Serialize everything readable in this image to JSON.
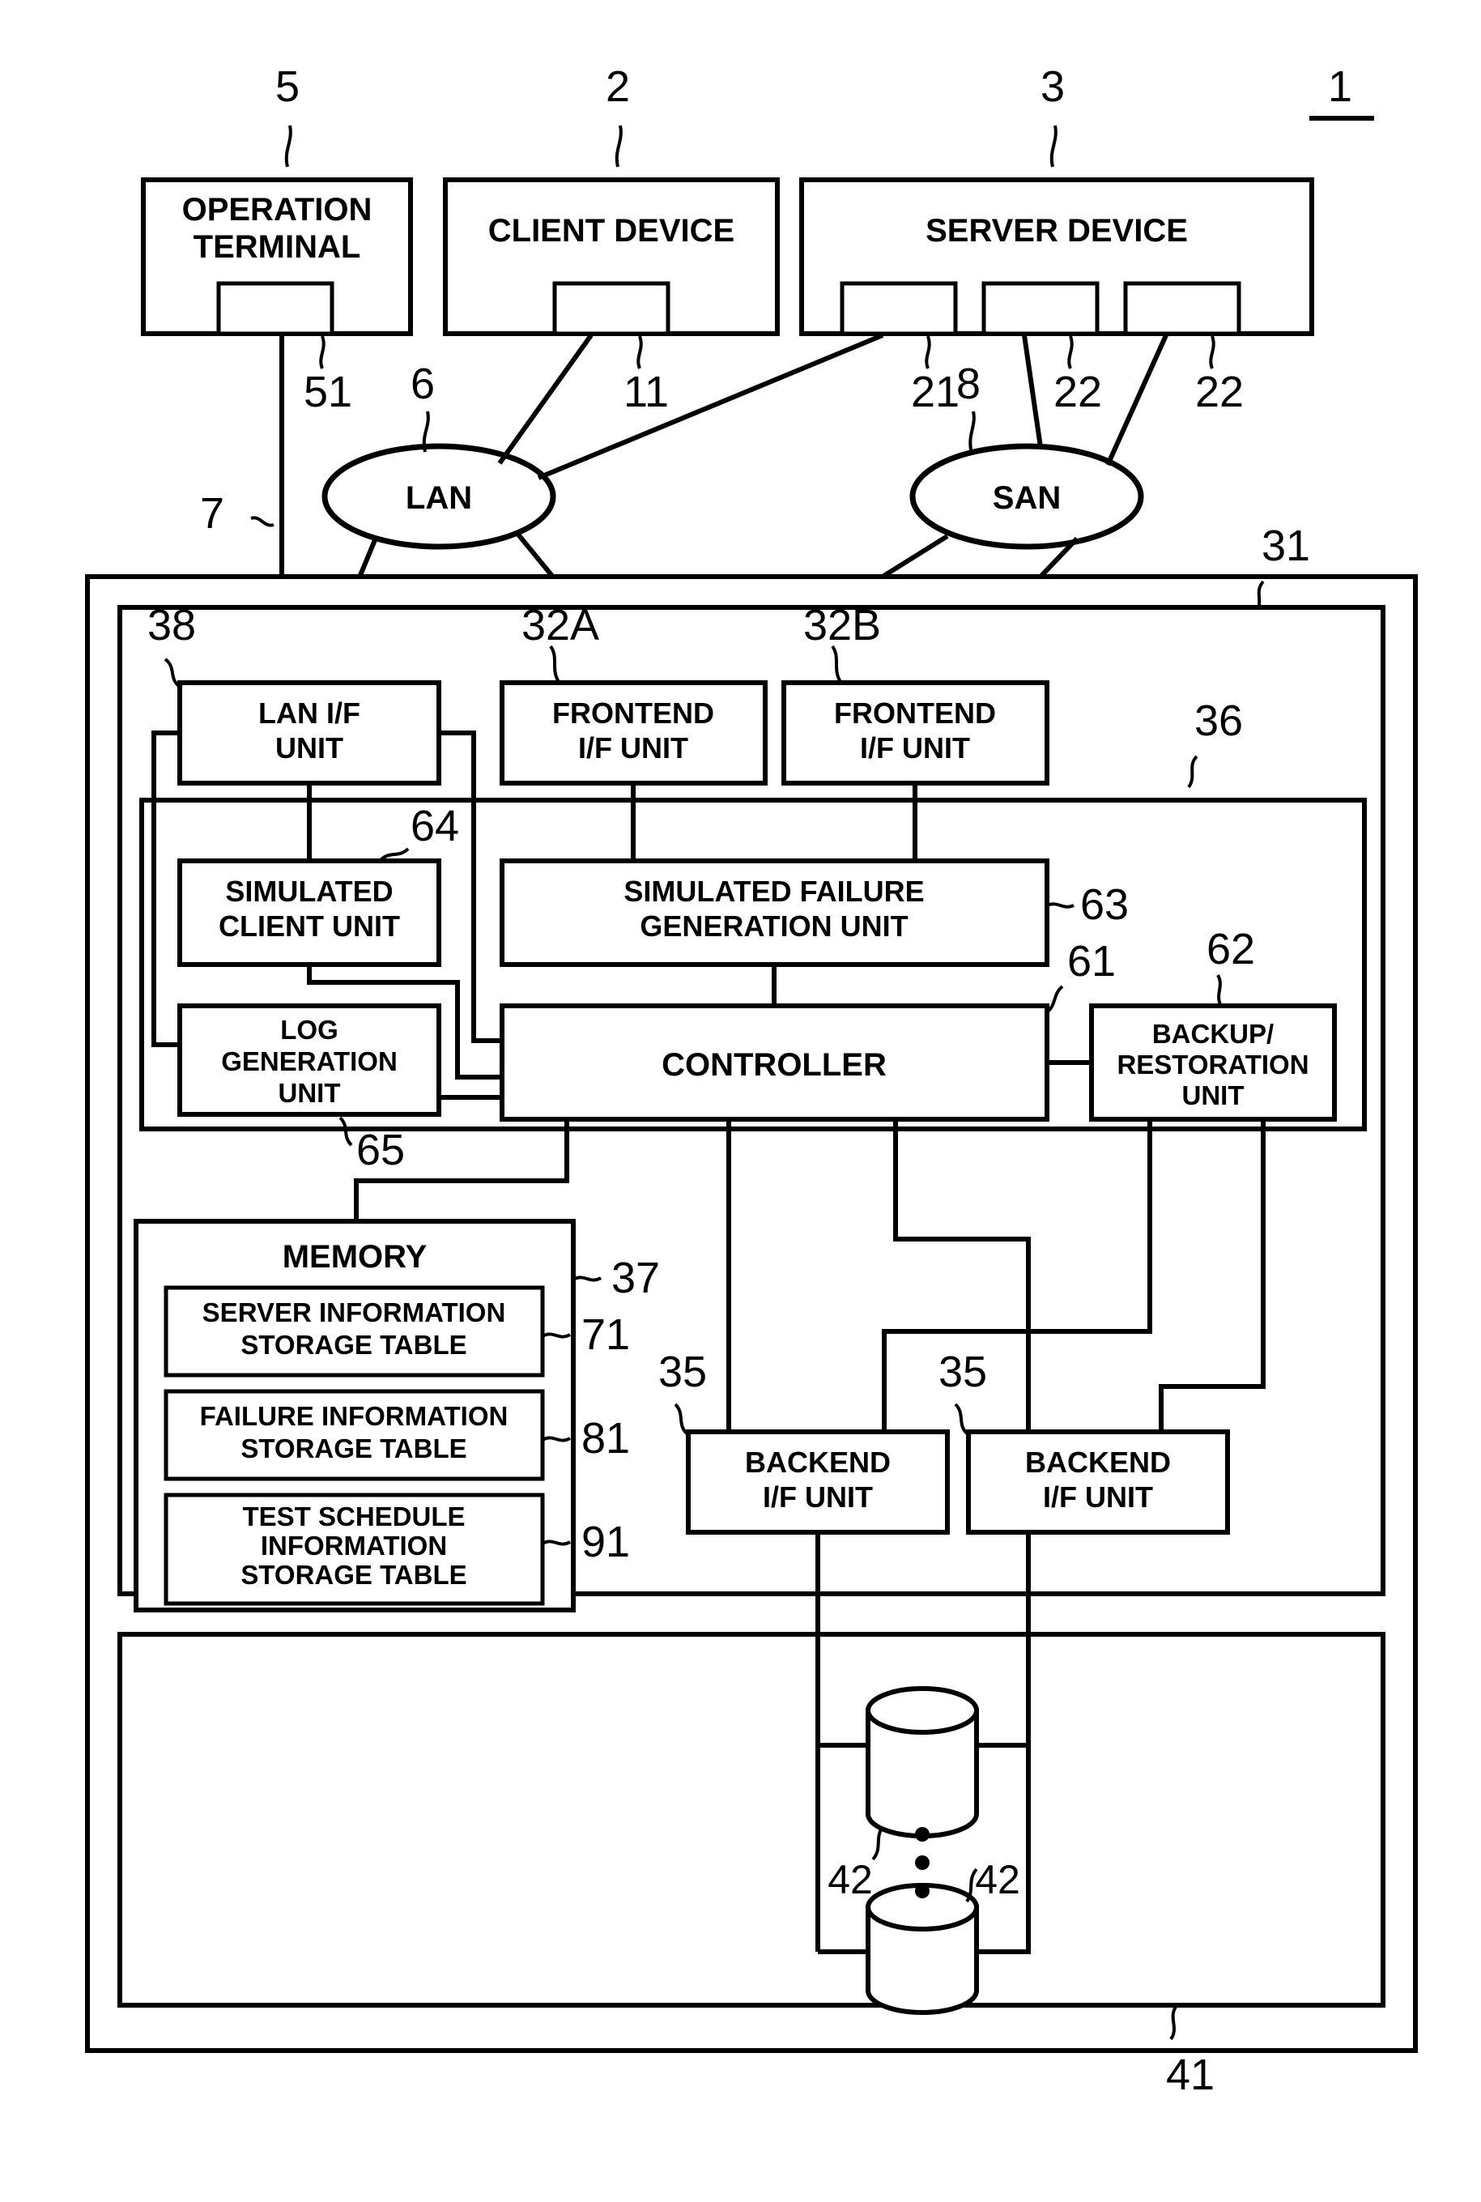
{
  "figure": {
    "figure_number": "1",
    "title_blocks": {
      "operation_terminal": "OPERATION\nTERMINAL",
      "operation_terminal_l1": "OPERATION",
      "operation_terminal_l2": "TERMINAL",
      "client_device": "CLIENT DEVICE",
      "server_device": "SERVER DEVICE"
    },
    "networks": {
      "lan": "LAN",
      "san": "SAN"
    },
    "interface_units": {
      "lan_if_l1": "LAN I/F",
      "lan_if_l2": "UNIT",
      "frontend_a_l1": "FRONTEND",
      "frontend_a_l2": "I/F UNIT",
      "frontend_b_l1": "FRONTEND",
      "frontend_b_l2": "I/F UNIT",
      "backend_a_l1": "BACKEND",
      "backend_a_l2": "I/F UNIT",
      "backend_b_l1": "BACKEND",
      "backend_b_l2": "I/F UNIT"
    },
    "processing_units": {
      "simulated_client_l1": "SIMULATED",
      "simulated_client_l2": "CLIENT UNIT",
      "simulated_failure_l1": "SIMULATED FAILURE",
      "simulated_failure_l2": "GENERATION UNIT",
      "log_generation_l1": "LOG",
      "log_generation_l2": "GENERATION",
      "log_generation_l3": "UNIT",
      "controller": "CONTROLLER",
      "backup_restoration_l1": "BACKUP/",
      "backup_restoration_l2": "RESTORATION",
      "backup_restoration_l3": "UNIT"
    },
    "memory": {
      "title": "MEMORY",
      "tables": [
        {
          "line1": "SERVER INFORMATION",
          "line2": "STORAGE TABLE",
          "ref": "71"
        },
        {
          "line1": "FAILURE INFORMATION",
          "line2": "STORAGE TABLE",
          "ref": "81"
        },
        {
          "line1": "TEST SCHEDULE",
          "line2": "INFORMATION",
          "line3": "STORAGE TABLE",
          "ref": "91"
        }
      ]
    },
    "reference_numerals": {
      "system": "1",
      "client_device": "2",
      "server_device": "3",
      "operation_terminal": "5",
      "lan": "6",
      "operation_link": "7",
      "san": "8",
      "client_port": "11",
      "server_port_lan": "21",
      "server_port_san_a": "22",
      "server_port_san_b": "22",
      "storage_apparatus": "31",
      "frontend_if_a": "32A",
      "frontend_if_b": "32B",
      "backend_if_a": "35",
      "backend_if_b": "35",
      "control_unit": "36",
      "memory": "37",
      "lan_if": "38",
      "disk_unit": "41",
      "disk_a": "42",
      "disk_b": "42",
      "controller": "61",
      "backup_restoration": "62",
      "simulated_failure": "63",
      "simulated_client": "64",
      "log_generation": "65",
      "operation_terminal_port": "51"
    },
    "colors": {
      "line": "#000000",
      "background": "#ffffff"
    }
  }
}
